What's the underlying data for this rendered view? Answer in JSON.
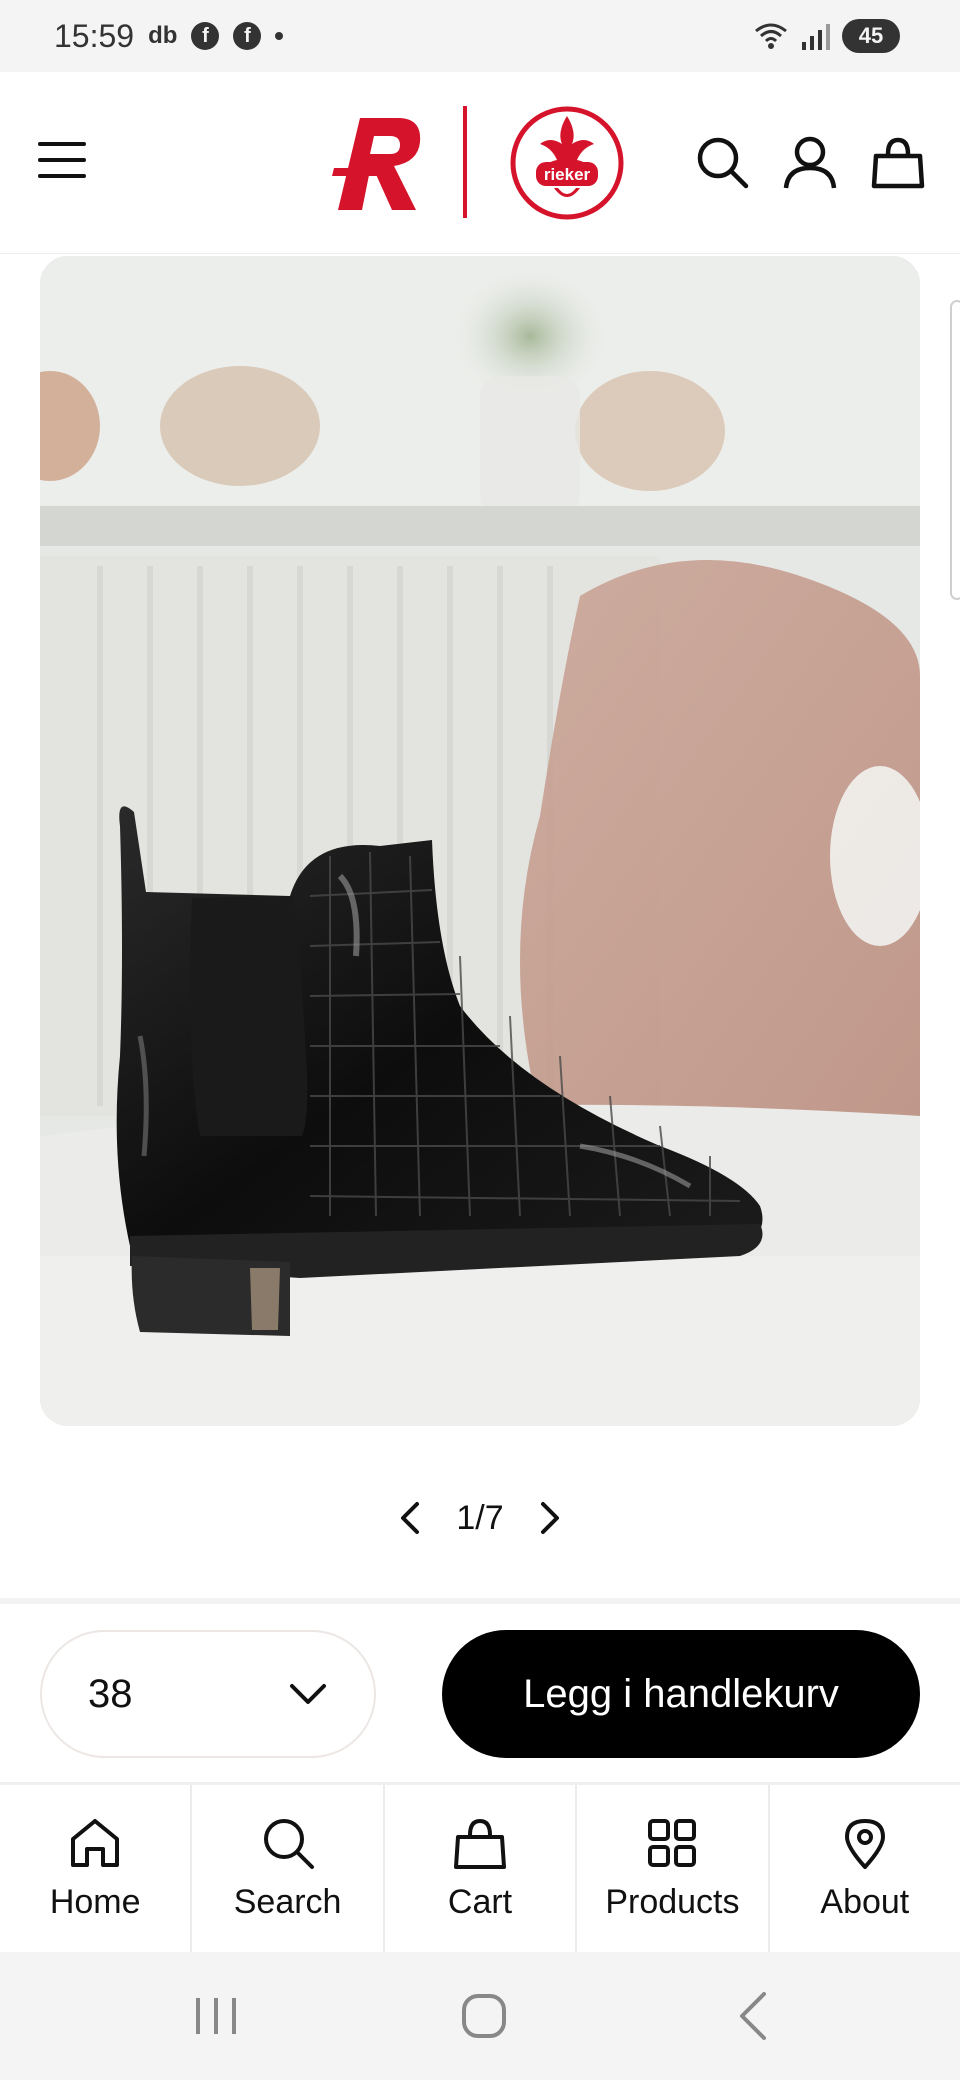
{
  "status_bar": {
    "time": "15:59",
    "app_icons": [
      "db",
      "f",
      "f"
    ],
    "battery": "45"
  },
  "header": {
    "brand_logo_r": "logo-r",
    "brand_logo_rieker": "rieker"
  },
  "product": {
    "image_alt": "black-patent-croc-chelsea-boot",
    "pager": "1/7"
  },
  "purchase": {
    "selected_size": "38",
    "add_to_cart_label": "Legg i handlekurv"
  },
  "tabs": [
    {
      "label": "Home",
      "icon": "home-icon"
    },
    {
      "label": "Search",
      "icon": "search-icon"
    },
    {
      "label": "Cart",
      "icon": "bag-icon"
    },
    {
      "label": "Products",
      "icon": "grid-icon"
    },
    {
      "label": "About",
      "icon": "location-pin-icon"
    }
  ],
  "colors": {
    "brand_red": "#d5142b",
    "button_black": "#000000"
  }
}
